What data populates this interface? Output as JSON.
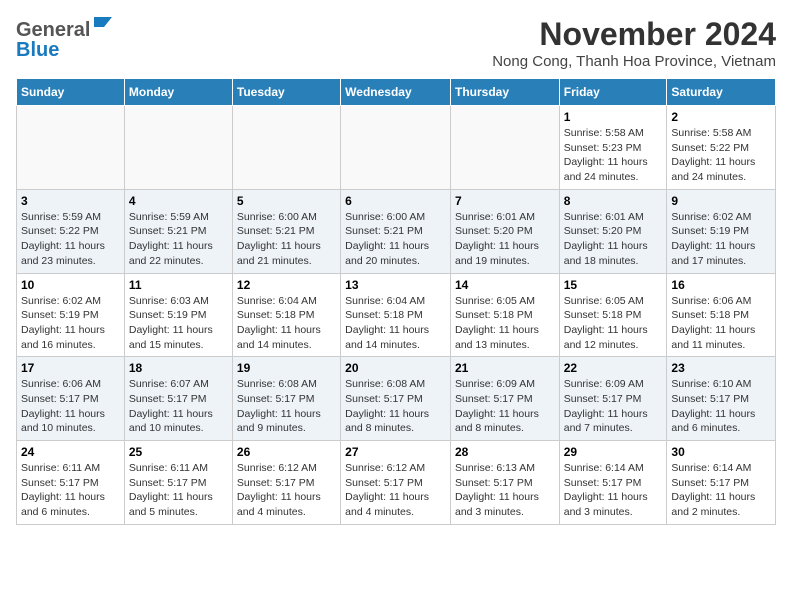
{
  "header": {
    "logo_general": "General",
    "logo_blue": "Blue",
    "month_title": "November 2024",
    "subtitle": "Nong Cong, Thanh Hoa Province, Vietnam"
  },
  "weekdays": [
    "Sunday",
    "Monday",
    "Tuesday",
    "Wednesday",
    "Thursday",
    "Friday",
    "Saturday"
  ],
  "weeks": [
    [
      {
        "day": "",
        "info": ""
      },
      {
        "day": "",
        "info": ""
      },
      {
        "day": "",
        "info": ""
      },
      {
        "day": "",
        "info": ""
      },
      {
        "day": "",
        "info": ""
      },
      {
        "day": "1",
        "info": "Sunrise: 5:58 AM\nSunset: 5:23 PM\nDaylight: 11 hours and 24 minutes."
      },
      {
        "day": "2",
        "info": "Sunrise: 5:58 AM\nSunset: 5:22 PM\nDaylight: 11 hours and 24 minutes."
      }
    ],
    [
      {
        "day": "3",
        "info": "Sunrise: 5:59 AM\nSunset: 5:22 PM\nDaylight: 11 hours and 23 minutes."
      },
      {
        "day": "4",
        "info": "Sunrise: 5:59 AM\nSunset: 5:21 PM\nDaylight: 11 hours and 22 minutes."
      },
      {
        "day": "5",
        "info": "Sunrise: 6:00 AM\nSunset: 5:21 PM\nDaylight: 11 hours and 21 minutes."
      },
      {
        "day": "6",
        "info": "Sunrise: 6:00 AM\nSunset: 5:21 PM\nDaylight: 11 hours and 20 minutes."
      },
      {
        "day": "7",
        "info": "Sunrise: 6:01 AM\nSunset: 5:20 PM\nDaylight: 11 hours and 19 minutes."
      },
      {
        "day": "8",
        "info": "Sunrise: 6:01 AM\nSunset: 5:20 PM\nDaylight: 11 hours and 18 minutes."
      },
      {
        "day": "9",
        "info": "Sunrise: 6:02 AM\nSunset: 5:19 PM\nDaylight: 11 hours and 17 minutes."
      }
    ],
    [
      {
        "day": "10",
        "info": "Sunrise: 6:02 AM\nSunset: 5:19 PM\nDaylight: 11 hours and 16 minutes."
      },
      {
        "day": "11",
        "info": "Sunrise: 6:03 AM\nSunset: 5:19 PM\nDaylight: 11 hours and 15 minutes."
      },
      {
        "day": "12",
        "info": "Sunrise: 6:04 AM\nSunset: 5:18 PM\nDaylight: 11 hours and 14 minutes."
      },
      {
        "day": "13",
        "info": "Sunrise: 6:04 AM\nSunset: 5:18 PM\nDaylight: 11 hours and 14 minutes."
      },
      {
        "day": "14",
        "info": "Sunrise: 6:05 AM\nSunset: 5:18 PM\nDaylight: 11 hours and 13 minutes."
      },
      {
        "day": "15",
        "info": "Sunrise: 6:05 AM\nSunset: 5:18 PM\nDaylight: 11 hours and 12 minutes."
      },
      {
        "day": "16",
        "info": "Sunrise: 6:06 AM\nSunset: 5:18 PM\nDaylight: 11 hours and 11 minutes."
      }
    ],
    [
      {
        "day": "17",
        "info": "Sunrise: 6:06 AM\nSunset: 5:17 PM\nDaylight: 11 hours and 10 minutes."
      },
      {
        "day": "18",
        "info": "Sunrise: 6:07 AM\nSunset: 5:17 PM\nDaylight: 11 hours and 10 minutes."
      },
      {
        "day": "19",
        "info": "Sunrise: 6:08 AM\nSunset: 5:17 PM\nDaylight: 11 hours and 9 minutes."
      },
      {
        "day": "20",
        "info": "Sunrise: 6:08 AM\nSunset: 5:17 PM\nDaylight: 11 hours and 8 minutes."
      },
      {
        "day": "21",
        "info": "Sunrise: 6:09 AM\nSunset: 5:17 PM\nDaylight: 11 hours and 8 minutes."
      },
      {
        "day": "22",
        "info": "Sunrise: 6:09 AM\nSunset: 5:17 PM\nDaylight: 11 hours and 7 minutes."
      },
      {
        "day": "23",
        "info": "Sunrise: 6:10 AM\nSunset: 5:17 PM\nDaylight: 11 hours and 6 minutes."
      }
    ],
    [
      {
        "day": "24",
        "info": "Sunrise: 6:11 AM\nSunset: 5:17 PM\nDaylight: 11 hours and 6 minutes."
      },
      {
        "day": "25",
        "info": "Sunrise: 6:11 AM\nSunset: 5:17 PM\nDaylight: 11 hours and 5 minutes."
      },
      {
        "day": "26",
        "info": "Sunrise: 6:12 AM\nSunset: 5:17 PM\nDaylight: 11 hours and 4 minutes."
      },
      {
        "day": "27",
        "info": "Sunrise: 6:12 AM\nSunset: 5:17 PM\nDaylight: 11 hours and 4 minutes."
      },
      {
        "day": "28",
        "info": "Sunrise: 6:13 AM\nSunset: 5:17 PM\nDaylight: 11 hours and 3 minutes."
      },
      {
        "day": "29",
        "info": "Sunrise: 6:14 AM\nSunset: 5:17 PM\nDaylight: 11 hours and 3 minutes."
      },
      {
        "day": "30",
        "info": "Sunrise: 6:14 AM\nSunset: 5:17 PM\nDaylight: 11 hours and 2 minutes."
      }
    ]
  ]
}
